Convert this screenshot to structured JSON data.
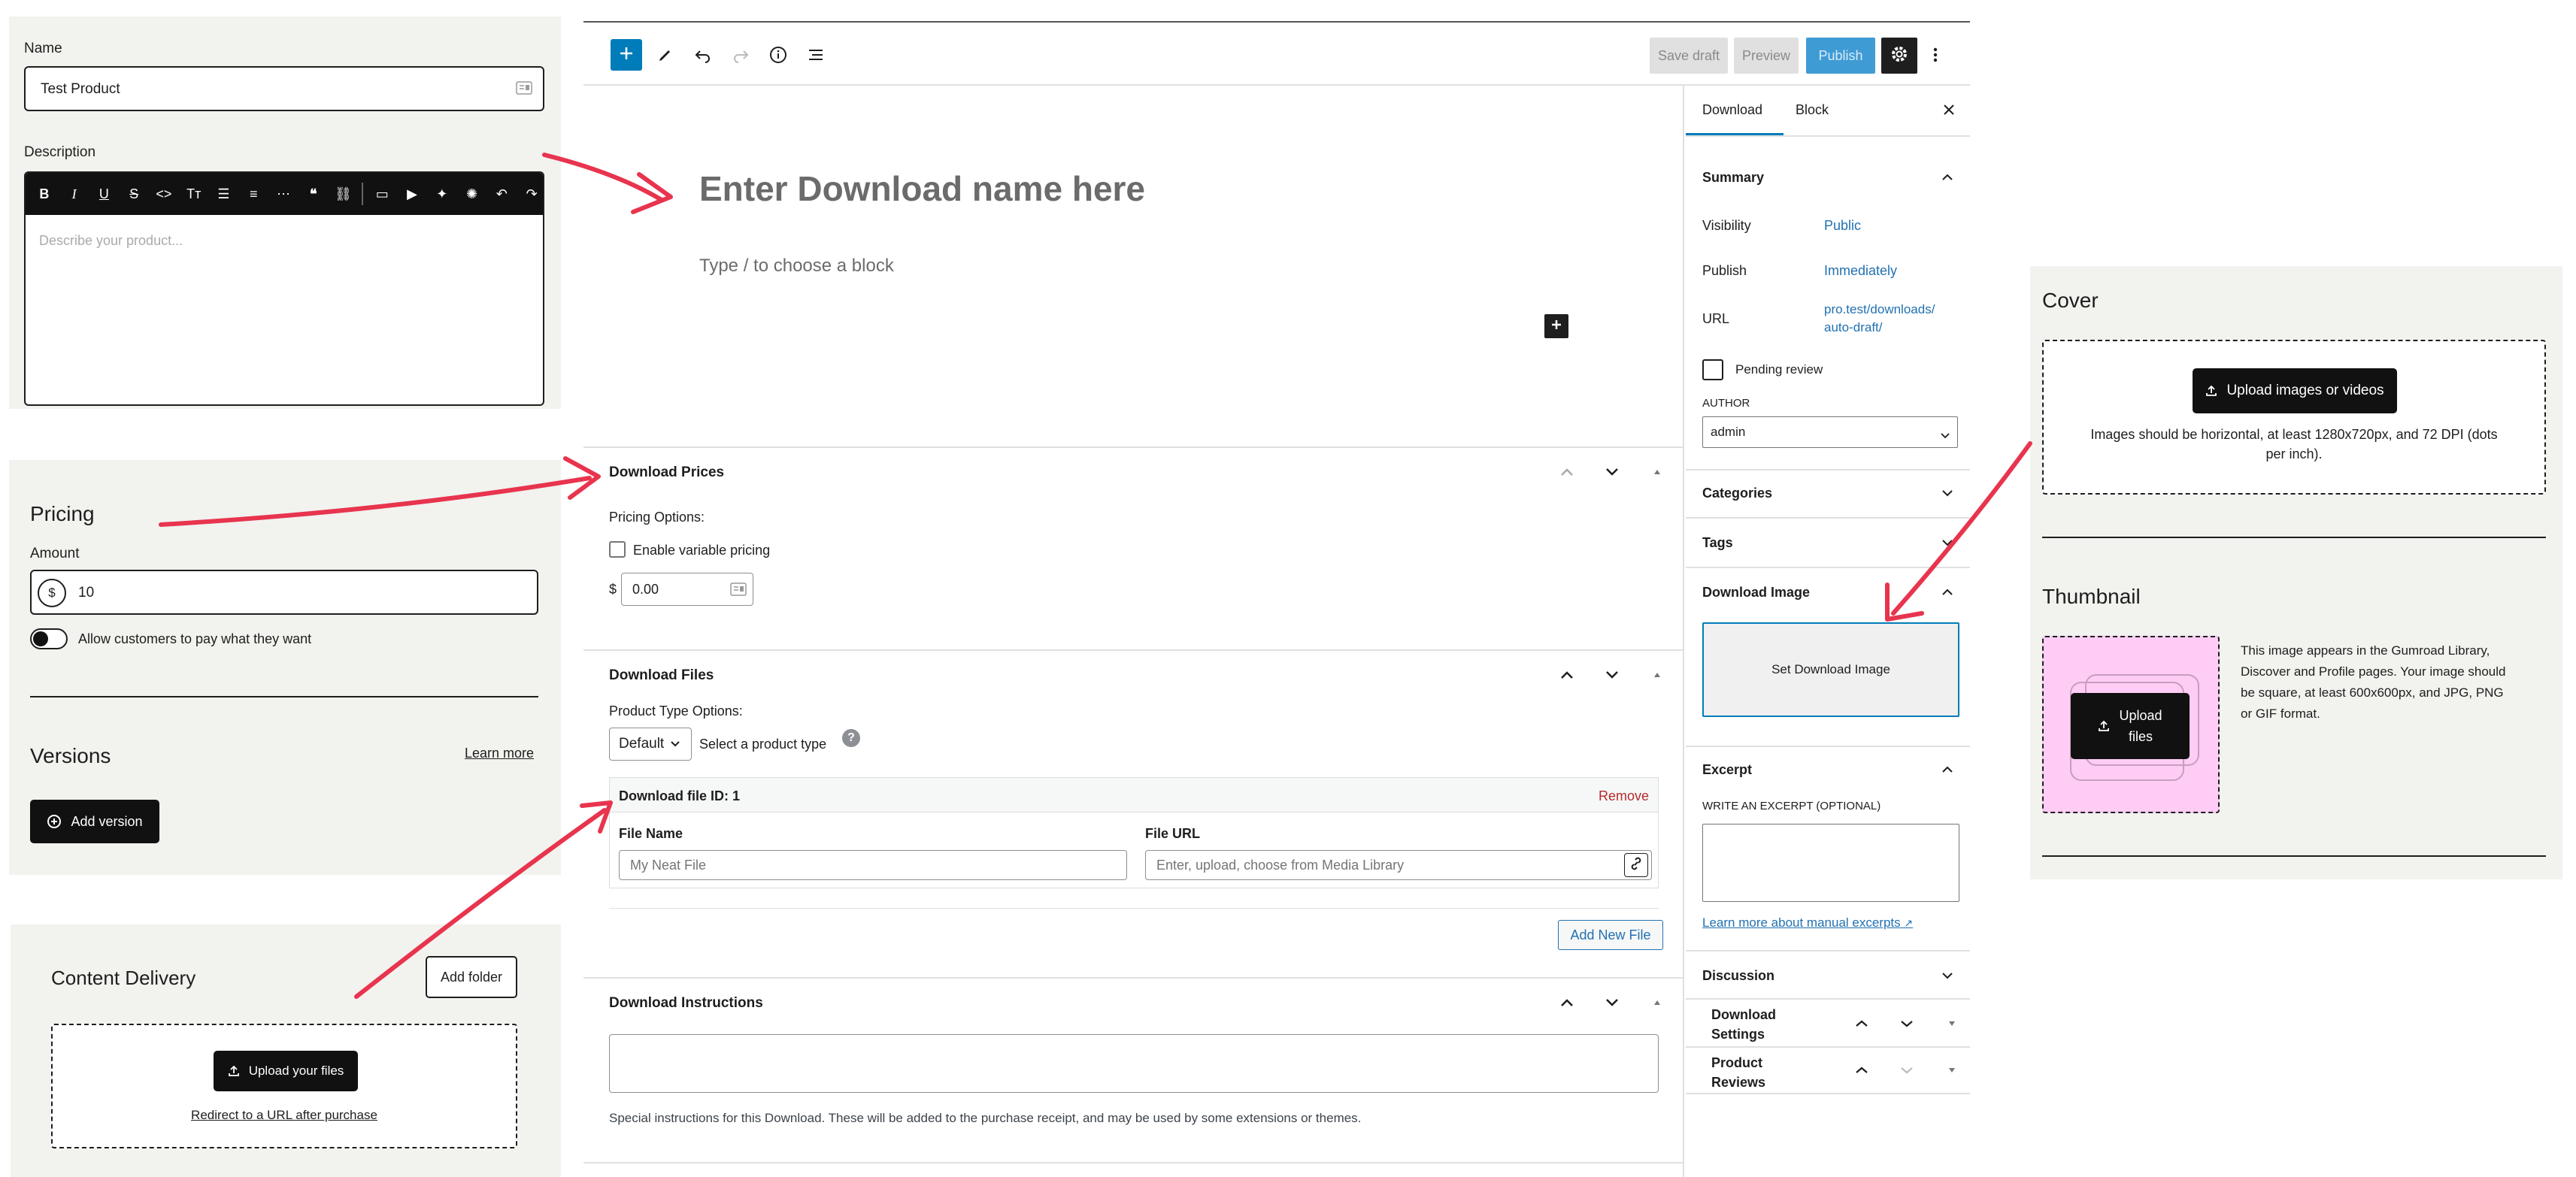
{
  "colors": {
    "accent": "#007cba",
    "arrow": "#e8344e",
    "gumroad_pink": "#ffccf5",
    "panel_bg": "#f2f2ee"
  },
  "gumroad_left": {
    "name_label": "Name",
    "name_value": "Test Product",
    "description_label": "Description",
    "description_placeholder": "Describe your product...",
    "toolbar_icons": [
      "bold-icon",
      "italic-icon",
      "underline-icon",
      "strikethrough-icon",
      "code-icon",
      "text-size-icon",
      "bullet-list-icon",
      "numbered-list-icon",
      "divider-icon",
      "quote-icon",
      "link-icon",
      "image-icon",
      "video-icon",
      "twitter-icon",
      "embed-icon",
      "undo-icon",
      "redo-icon"
    ],
    "pricing_title": "Pricing",
    "amount_label": "Amount",
    "currency_symbol": "$",
    "amount_value": "10",
    "pwyw_label": "Allow customers to pay what they want",
    "versions_title": "Versions",
    "learn_more": "Learn more",
    "add_version": "Add version",
    "content_delivery_title": "Content Delivery",
    "add_folder": "Add folder",
    "upload_files": "Upload your files",
    "redirect_link": "Redirect to a URL after purchase"
  },
  "wp": {
    "topbar": {
      "save_draft": "Save draft",
      "preview": "Preview",
      "publish": "Publish"
    },
    "title_placeholder": "Enter Download name here",
    "block_placeholder": "Type / to choose a block",
    "prices": {
      "title": "Download Prices",
      "pricing_options_label": "Pricing Options:",
      "variable_pricing": "Enable variable pricing",
      "currency": "$",
      "price_value": "0.00"
    },
    "files": {
      "title": "Download Files",
      "product_type_label": "Product Type Options:",
      "type_select": "Default",
      "type_hint": "Select a product type",
      "help": "?",
      "file_header": "Download file ID: 1",
      "remove": "Remove",
      "file_name_label": "File Name",
      "file_name_placeholder": "My Neat File",
      "file_url_label": "File URL",
      "file_url_placeholder": "Enter, upload, choose from Media Library",
      "add_new_file": "Add New File"
    },
    "instructions": {
      "title": "Download Instructions",
      "help": "Special instructions for this Download. These will be added to the purchase receipt, and may be used by some extensions or themes."
    },
    "sidebar": {
      "tab_download": "Download",
      "tab_block": "Block",
      "summary_title": "Summary",
      "visibility_label": "Visibility",
      "visibility_value": "Public",
      "publish_label": "Publish",
      "publish_value": "Immediately",
      "url_label": "URL",
      "url_value_1": "pro.test/downloads/",
      "url_value_2": "auto-draft/",
      "pending_review": "Pending review",
      "author_label": "AUTHOR",
      "author_value": "admin",
      "categories": "Categories",
      "tags": "Tags",
      "download_image": "Download Image",
      "set_download_image": "Set Download Image",
      "excerpt": "Excerpt",
      "excerpt_label": "WRITE AN EXCERPT (OPTIONAL)",
      "excerpt_link": "Learn more about manual excerpts",
      "discussion": "Discussion",
      "download_settings_1": "Download",
      "download_settings_2": "Settings",
      "product_reviews_1": "Product",
      "product_reviews_2": "Reviews"
    }
  },
  "gumroad_right": {
    "cover_title": "Cover",
    "upload_images": "Upload images or videos",
    "cover_hint_1": "Images should be horizontal, at least 1280x720px, and 72 DPI (dots",
    "cover_hint_2": "per inch).",
    "thumbnail_title": "Thumbnail",
    "upload_files_1": "Upload",
    "upload_files_2": "files",
    "thumb_hint_1": "This image appears in the Gumroad Library,",
    "thumb_hint_2": "Discover and Profile pages. Your image should",
    "thumb_hint_3": "be square, at least 600x600px, and JPG, PNG",
    "thumb_hint_4": "or GIF format."
  }
}
